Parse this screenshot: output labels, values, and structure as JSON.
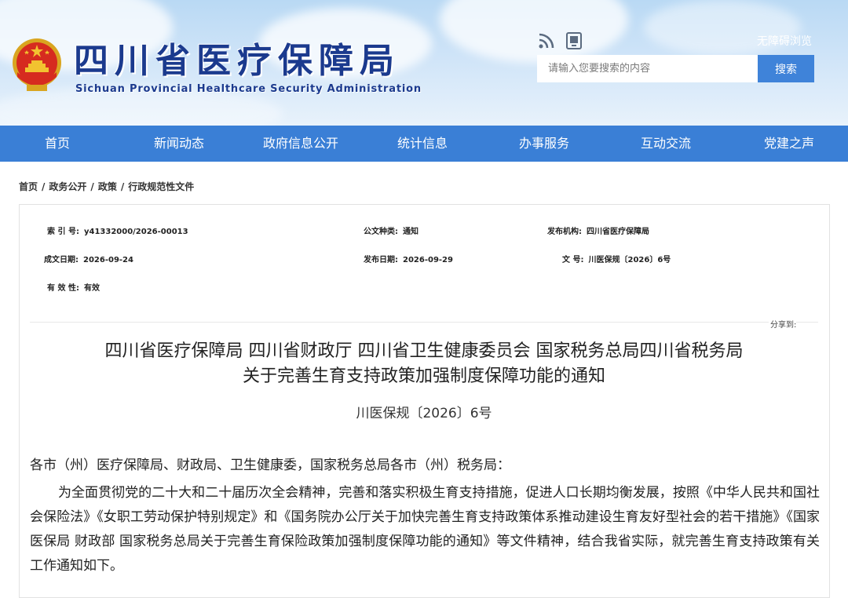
{
  "header": {
    "site_title": "四川省医疗保障局",
    "site_subtitle": "Sichuan Provincial Healthcare Security Administration",
    "accessible_link": "无障碍浏览",
    "search_placeholder": "请输入您要搜索的内容",
    "search_button": "搜索",
    "icons": [
      "rss-icon",
      "mobile-site-icon"
    ]
  },
  "nav": {
    "items": [
      "首页",
      "新闻动态",
      "政府信息公开",
      "统计信息",
      "办事服务",
      "互动交流",
      "党建之声"
    ]
  },
  "breadcrumb": [
    "首页",
    "政务公开",
    "政策",
    "行政规范性文件"
  ],
  "meta": {
    "index_label": "索 引 号:",
    "index_value": "y41332000/2026-00013",
    "doc_type_label": "公文种类:",
    "doc_type_value": "通知",
    "issuer_label": "发布机构:",
    "issuer_value": "四川省医疗保障局",
    "created_label": "成文日期:",
    "created_value": "2026-09-24",
    "published_label": "发布日期:",
    "published_value": "2026-09-29",
    "doc_no_label": "文 号:",
    "doc_no_value": "川医保规〔2026〕6号",
    "validity_label": "有 效 性:",
    "validity_value": "有效",
    "share_label": "分享到:"
  },
  "article": {
    "title_line1": "四川省医疗保障局 四川省财政厅 四川省卫生健康委员会 国家税务总局四川省税务局",
    "title_line2": "关于完善生育支持政策加强制度保障功能的通知",
    "doc_number": "川医保规〔2026〕6号",
    "salutation": "各市（州）医疗保障局、财政局、卫生健康委，国家税务总局各市（州）税务局：",
    "paragraph1": "为全面贯彻党的二十大和二十届历次全会精神，完善和落实积极生育支持措施，促进人口长期均衡发展，按照《中华人民共和国社会保险法》《女职工劳动保护特别规定》和《国务院办公厅关于加快完善生育支持政策体系推动建设生育友好型社会的若干措施》《国家医保局 财政部 国家税务总局关于完善生育保险政策加强制度保障功能的通知》等文件精神，结合我省实际，就完善生育支持政策有关工作通知如下。"
  },
  "colors": {
    "nav_bg": "#3a7fd6",
    "search_button": "#3f83d9",
    "title_blue": "#1b3a8e"
  }
}
